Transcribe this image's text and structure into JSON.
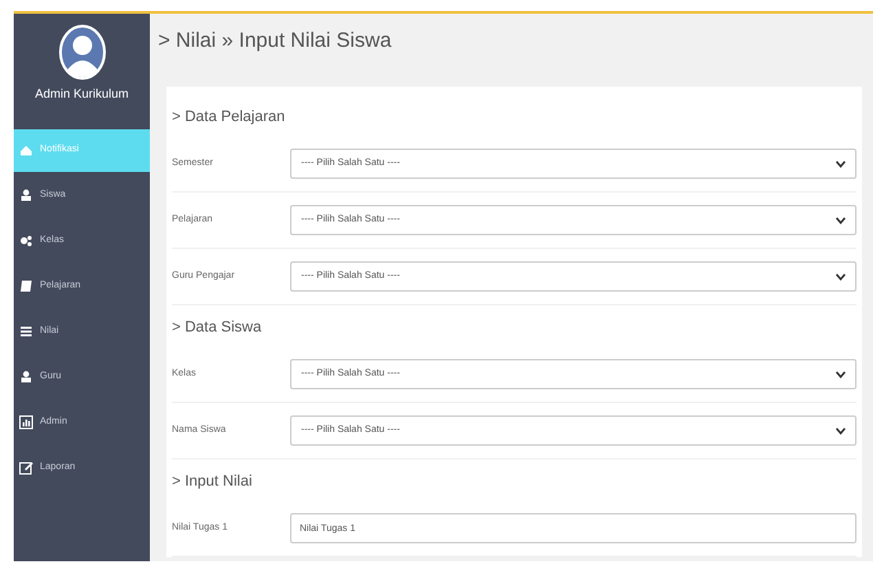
{
  "sidebar": {
    "user_name": "Admin Kurikulum",
    "items": [
      {
        "label": "Notifikasi",
        "selected": true
      },
      {
        "label": "Siswa",
        "selected": false
      },
      {
        "label": "Kelas",
        "selected": false
      },
      {
        "label": "Pelajaran",
        "selected": false
      },
      {
        "label": "Nilai",
        "selected": false
      },
      {
        "label": "Guru",
        "selected": false
      },
      {
        "label": "Admin",
        "selected": false
      },
      {
        "label": "Laporan",
        "selected": false
      }
    ]
  },
  "page_title": "> Nilai » Input Nilai Siswa",
  "sections": [
    {
      "heading": "> Data Pelajaran",
      "fields": [
        {
          "label": "Semester",
          "kind": "select",
          "value": "---- Pilih Salah Satu ----"
        },
        {
          "label": "Pelajaran",
          "kind": "select",
          "value": "---- Pilih Salah Satu ----"
        },
        {
          "label": "Guru Pengajar",
          "kind": "select",
          "value": "---- Pilih Salah Satu ----"
        }
      ]
    },
    {
      "heading": "> Data Siswa",
      "fields": [
        {
          "label": "Kelas",
          "kind": "select",
          "value": "---- Pilih Salah Satu ----"
        },
        {
          "label": "Nama Siswa",
          "kind": "select",
          "value": "---- Pilih Salah Satu ----"
        }
      ]
    },
    {
      "heading": "> Input Nilai",
      "fields": [
        {
          "label": "Nilai Tugas 1",
          "kind": "input",
          "placeholder": "Nilai Tugas 1"
        }
      ]
    }
  ]
}
